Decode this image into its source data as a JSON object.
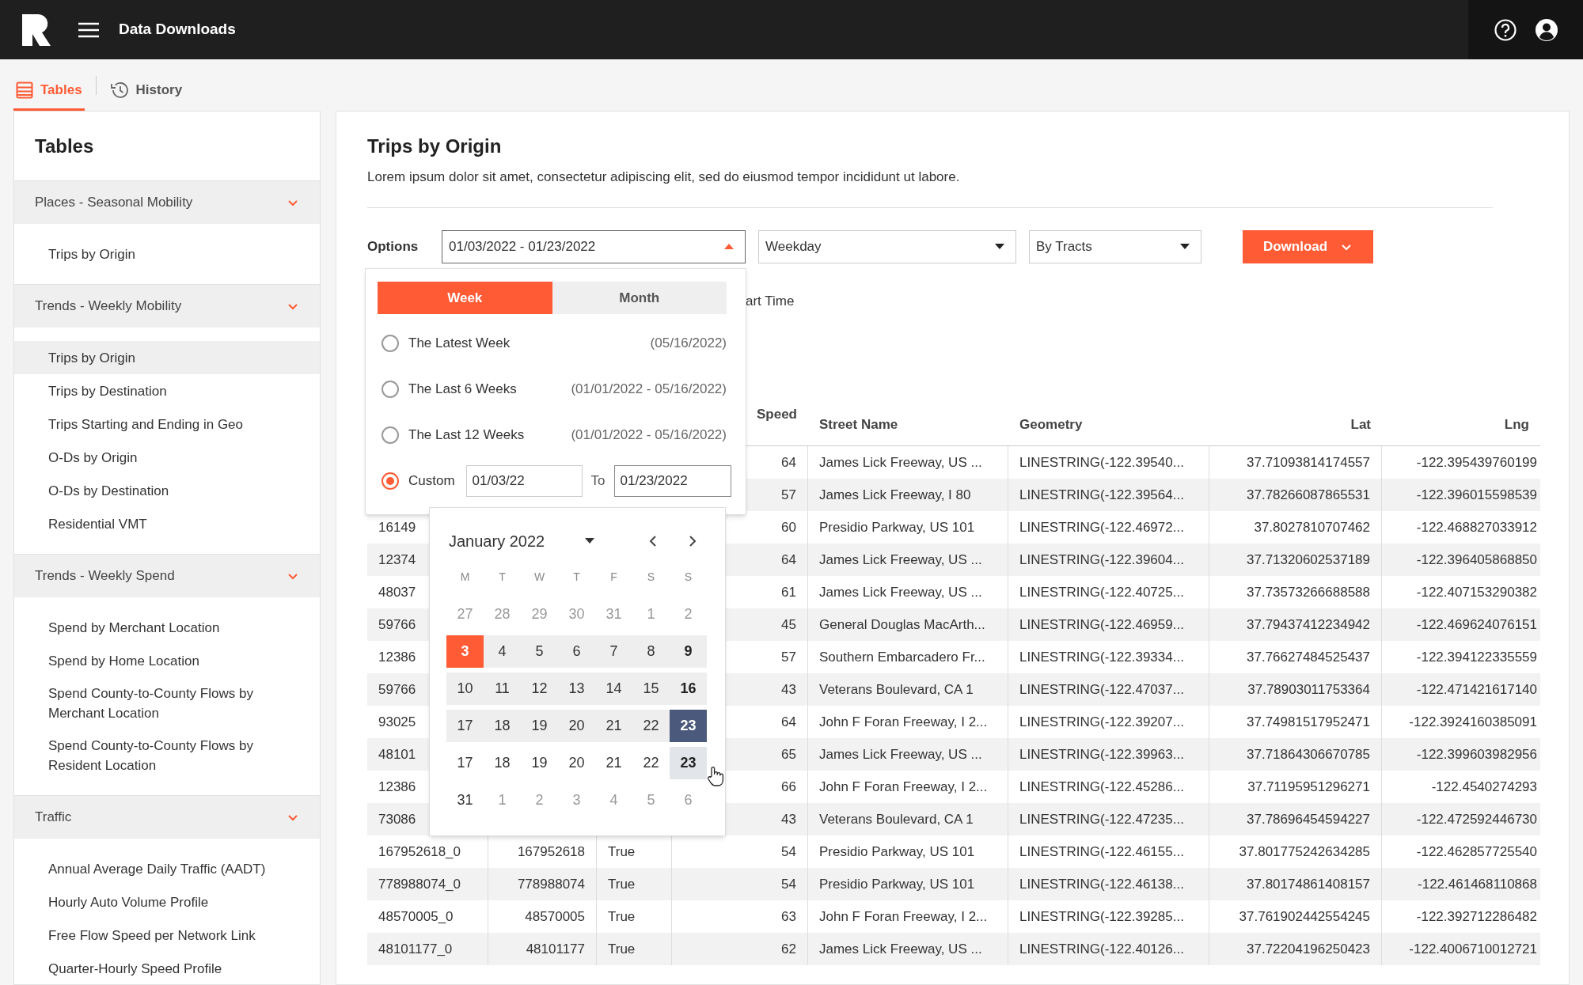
{
  "header": {
    "title": "Data Downloads"
  },
  "nav_tabs": [
    {
      "label": "Tables",
      "selected": true
    },
    {
      "label": "History",
      "selected": false
    }
  ],
  "sidebar": {
    "title": "Tables",
    "sections": [
      {
        "label": "Places - Seasonal Mobility",
        "expanded": true,
        "items": [
          {
            "label": "Trips by Origin",
            "selected": false
          }
        ]
      },
      {
        "label": "Trends - Weekly Mobility",
        "expanded": true,
        "items": [
          {
            "label": "Trips by Origin",
            "selected": true
          },
          {
            "label": "Trips by Destination",
            "selected": false
          },
          {
            "label": "Trips Starting and Ending in Geo",
            "selected": false
          },
          {
            "label": "O-Ds by Origin",
            "selected": false
          },
          {
            "label": "O-Ds by Destination",
            "selected": false
          },
          {
            "label": "Residential VMT",
            "selected": false
          }
        ]
      },
      {
        "label": "Trends - Weekly Spend",
        "expanded": true,
        "items": [
          {
            "label": "Spend by Merchant Location",
            "selected": false
          },
          {
            "label": "Spend by Home Location",
            "selected": false
          },
          {
            "label": "Spend County-to-County Flows by Merchant Location",
            "selected": false
          },
          {
            "label": "Spend County-to-County Flows by Resident Location",
            "selected": false
          }
        ]
      },
      {
        "label": "Traffic",
        "expanded": true,
        "items": [
          {
            "label": "Annual Average Daily Traffic (AADT)",
            "selected": false
          },
          {
            "label": "Hourly Auto Volume Profile",
            "selected": false
          },
          {
            "label": "Free Flow Speed per Network Link",
            "selected": false
          },
          {
            "label": "Quarter-Hourly Speed Profile",
            "selected": false
          }
        ]
      }
    ]
  },
  "main": {
    "title": "Trips by Origin",
    "description": "Lorem ipsum dolor sit amet, consectetur adipiscing elit, sed do eiusmod tempor incididunt ut labore.",
    "options": {
      "label": "Options",
      "date_range": {
        "value": "01/03/2022 - 01/23/2022",
        "expanded": true
      },
      "day_type": "Weekday",
      "geography": "By Tracts",
      "download": "Download"
    },
    "partial_option": "art Time",
    "table": {
      "columns": {
        "speed": "Speed",
        "street_name": "Street Name",
        "geometry": "Geometry",
        "lat": "Lat",
        "lng": "Lng"
      },
      "rows": [
        {
          "speed": "64",
          "street_name": "James Lick Freeway, US ...",
          "geometry": "LINESTRING(-122.39540...",
          "lat": "37.71093814174557",
          "lng": "-122.395439760199"
        },
        {
          "speed": "57",
          "street_name": "James Lick Freeway, I 80",
          "geometry": "LINESTRING(-122.39564...",
          "lat": "37.78266087865531",
          "lng": "-122.396015598539"
        },
        {
          "column_1": "16149",
          "speed": "60",
          "street_name": "Presidio Parkway, US 101",
          "geometry": "LINESTRING(-122.46972...",
          "lat": "37.8027810707462",
          "lng": "-122.468827033912"
        },
        {
          "column_1": "12374",
          "speed": "64",
          "street_name": "James Lick Freeway, US ...",
          "geometry": "LINESTRING(-122.39604...",
          "lat": "37.71320602537189",
          "lng": "-122.396405868850"
        },
        {
          "column_1": "48037",
          "speed": "61",
          "street_name": "James Lick Freeway, US ...",
          "geometry": "LINESTRING(-122.40725...",
          "lat": "37.73573266688588",
          "lng": "-122.407153290382"
        },
        {
          "column_1": "59766",
          "speed": "45",
          "street_name": "General Douglas MacArth...",
          "geometry": "LINESTRING(-122.46959...",
          "lat": "37.79437412234942",
          "lng": "-122.469624076151"
        },
        {
          "column_1": "12386",
          "speed": "57",
          "street_name": "Southern Embarcadero Fr...",
          "geometry": "LINESTRING(-122.39334...",
          "lat": "37.76627484525437",
          "lng": "-122.394122335559"
        },
        {
          "column_1": "59766",
          "speed": "43",
          "street_name": "Veterans Boulevard, CA 1",
          "geometry": "LINESTRING(-122.47037...",
          "lat": "37.78903011753364",
          "lng": "-122.471421617140"
        },
        {
          "column_1": "93025",
          "speed": "64",
          "street_name": "John F Foran Freeway, I 2...",
          "geometry": "LINESTRING(-122.39207...",
          "lat": "37.74981517952471",
          "lng": "-122.3924160385091"
        },
        {
          "column_1": "48101",
          "speed": "65",
          "street_name": "James Lick Freeway, US ...",
          "geometry": "LINESTRING(-122.39963...",
          "lat": "37.71864306670785",
          "lng": "-122.399603982956"
        },
        {
          "column_1": "12386",
          "speed": "66",
          "street_name": "John F Foran Freeway, I 2...",
          "geometry": "LINESTRING(-122.45286...",
          "lat": "37.71195951296271",
          "lng": "-122.4540274293"
        },
        {
          "column_1": "73086",
          "speed": "43",
          "street_name": "Veterans Boulevard, CA 1",
          "geometry": "LINESTRING(-122.47235...",
          "lat": "37.78696454594227",
          "lng": "-122.472592446730"
        },
        {
          "column_1": "167952618_0",
          "column_2": "167952618",
          "column_3": "True",
          "speed": "54",
          "street_name": "Presidio Parkway, US 101",
          "geometry": "LINESTRING(-122.46155...",
          "lat": "37.801775242634285",
          "lng": "-122.462857725540"
        },
        {
          "column_1": "778988074_0",
          "column_2": "778988074",
          "column_3": "True",
          "speed": "54",
          "street_name": "Presidio Parkway, US 101",
          "geometry": "LINESTRING(-122.46138...",
          "lat": "37.80174861408157",
          "lng": "-122.461468110868"
        },
        {
          "column_1": "48570005_0",
          "column_2": "48570005",
          "column_3": "True",
          "speed": "63",
          "street_name": "John F Foran Freeway, I 2...",
          "geometry": "LINESTRING(-122.39285...",
          "lat": "37.761902442554245",
          "lng": "-122.392712286482"
        },
        {
          "column_1": "48101177_0",
          "column_2": "48101177",
          "column_3": "True",
          "speed": "62",
          "street_name": "James Lick Freeway, US ...",
          "geometry": "LINESTRING(-122.40126...",
          "lat": "37.72204196250423",
          "lng": "-122.4006710012721"
        }
      ]
    },
    "date_picker": {
      "tabs": [
        {
          "label": "Week",
          "selected": true
        },
        {
          "label": "Month",
          "selected": false
        }
      ],
      "presets": [
        {
          "label": "The Latest Week",
          "range": "(05/16/2022)",
          "selected": false
        },
        {
          "label": "The Last 6 Weeks",
          "range": "(01/01/2022 - 05/16/2022)",
          "selected": false
        },
        {
          "label": "The Last 12 Weeks",
          "range": "(01/01/2022 - 05/16/2022)",
          "selected": false
        }
      ],
      "custom": {
        "label": "Custom",
        "selected": true,
        "from": "01/03/22",
        "to_label": "To",
        "to": "01/23/2022"
      },
      "calendar": {
        "month": "January 2022",
        "weekdays": [
          "M",
          "T",
          "W",
          "T",
          "F",
          "S",
          "S"
        ],
        "weeks": [
          [
            {
              "day": "27",
              "kind": "outside"
            },
            {
              "day": "28",
              "kind": "outside"
            },
            {
              "day": "29",
              "kind": "outside"
            },
            {
              "day": "30",
              "kind": "outside"
            },
            {
              "day": "31",
              "kind": "outside"
            },
            {
              "day": "1",
              "kind": "outside"
            },
            {
              "day": "2",
              "kind": "outside"
            }
          ],
          [
            {
              "day": "3",
              "kind": "start"
            },
            {
              "day": "4",
              "kind": "range"
            },
            {
              "day": "5",
              "kind": "range"
            },
            {
              "day": "6",
              "kind": "range"
            },
            {
              "day": "7",
              "kind": "range"
            },
            {
              "day": "8",
              "kind": "range"
            },
            {
              "day": "9",
              "kind": "range_bold"
            }
          ],
          [
            {
              "day": "10",
              "kind": "range"
            },
            {
              "day": "11",
              "kind": "range"
            },
            {
              "day": "12",
              "kind": "range"
            },
            {
              "day": "13",
              "kind": "range"
            },
            {
              "day": "14",
              "kind": "range"
            },
            {
              "day": "15",
              "kind": "range"
            },
            {
              "day": "16",
              "kind": "range_bold"
            }
          ],
          [
            {
              "day": "17",
              "kind": "range"
            },
            {
              "day": "18",
              "kind": "range"
            },
            {
              "day": "19",
              "kind": "range"
            },
            {
              "day": "20",
              "kind": "range"
            },
            {
              "day": "21",
              "kind": "range"
            },
            {
              "day": "22",
              "kind": "range"
            },
            {
              "day": "23",
              "kind": "end"
            }
          ],
          [
            {
              "day": "17",
              "kind": "normal"
            },
            {
              "day": "18",
              "kind": "normal"
            },
            {
              "day": "19",
              "kind": "normal"
            },
            {
              "day": "20",
              "kind": "normal"
            },
            {
              "day": "21",
              "kind": "normal"
            },
            {
              "day": "22",
              "kind": "normal"
            },
            {
              "day": "23",
              "kind": "hover"
            }
          ],
          [
            {
              "day": "31",
              "kind": "normal"
            },
            {
              "day": "1",
              "kind": "outside"
            },
            {
              "day": "2",
              "kind": "outside"
            },
            {
              "day": "3",
              "kind": "outside"
            },
            {
              "day": "4",
              "kind": "outside"
            },
            {
              "day": "5",
              "kind": "outside"
            },
            {
              "day": "6",
              "kind": "outside"
            }
          ]
        ]
      }
    }
  }
}
